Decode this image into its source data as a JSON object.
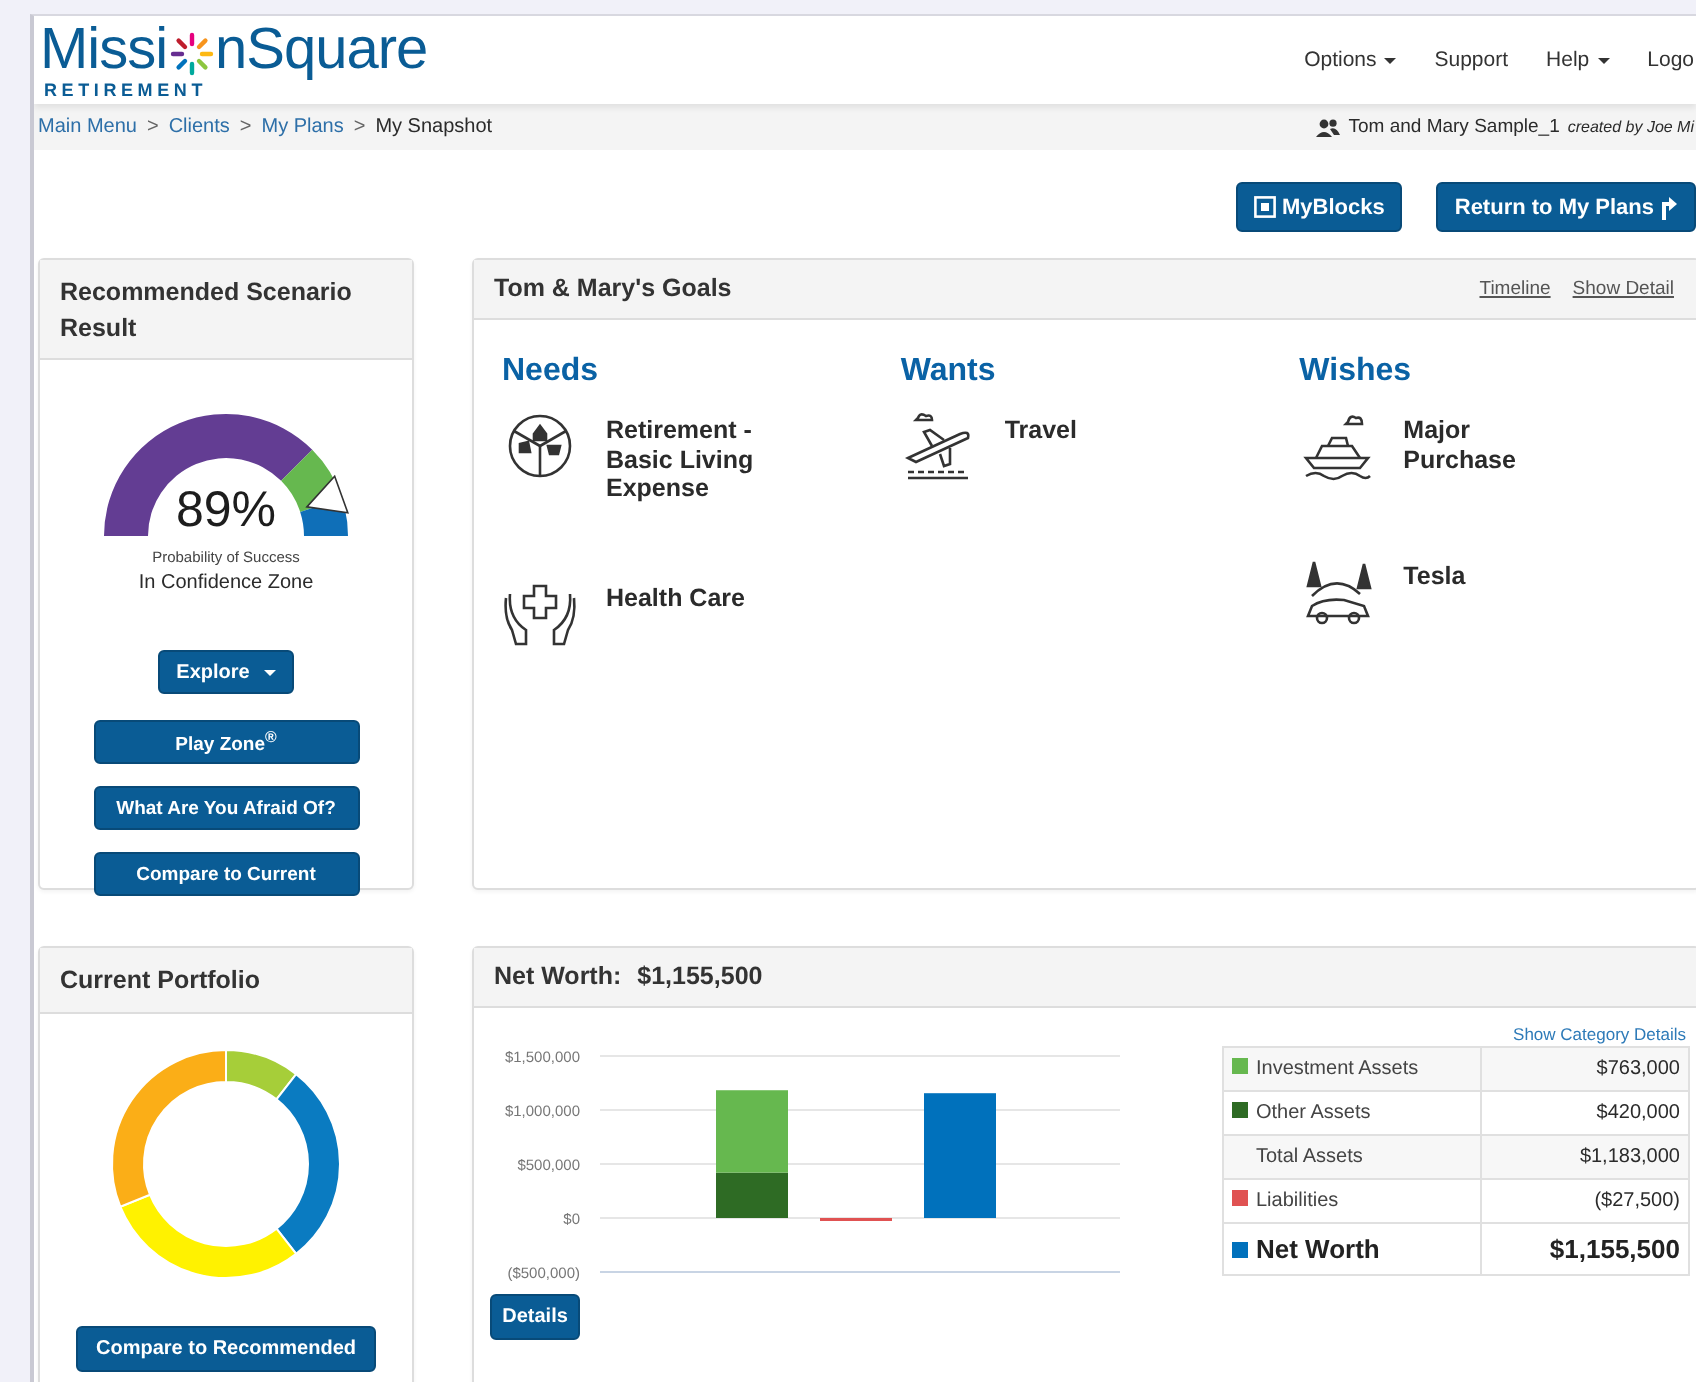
{
  "header": {
    "logo": {
      "before": "Missi",
      "after": "nSquare",
      "tagline": "RETIREMENT"
    },
    "nav": [
      {
        "label": "Options",
        "dropdown": true
      },
      {
        "label": "Support",
        "dropdown": false
      },
      {
        "label": "Help",
        "dropdown": true
      },
      {
        "label": "Logo",
        "dropdown": false
      }
    ]
  },
  "breadcrumb": {
    "separator": ">",
    "items": [
      {
        "label": "Main Menu",
        "link": true
      },
      {
        "label": "Clients",
        "link": true
      },
      {
        "label": "My Plans",
        "link": true
      },
      {
        "label": "My Snapshot",
        "link": false
      }
    ],
    "user": "Tom and Mary Sample_1",
    "created_by": "created by Joe Mi"
  },
  "actions": [
    "MyBlocks",
    "Return to My Plans"
  ],
  "scenario": {
    "title": "Recommended Scenario Result",
    "level": 0.89,
    "percent": "89%",
    "caption": "Probability of Success",
    "zone": "In Confidence Zone",
    "explore": "Explore",
    "buttons": [
      "Play Zone$^{®}$",
      "What Are You Afraid Of?",
      "Compare to Current"
    ]
  },
  "goals": {
    "title": "Tom & Mary's Goals",
    "links": [
      "Timeline",
      "Show Detail"
    ],
    "groups": [
      {
        "title": "Needs",
        "items": [
          "Retirement - Basic Living Expense",
          "Health Care"
        ]
      },
      {
        "title": "Wants",
        "items": [
          "Travel"
        ]
      },
      {
        "title": "Wishes",
        "items": [
          "Major Purchase",
          "Tesla"
        ]
      }
    ]
  },
  "portfolio": {
    "title": "Current Portfolio",
    "button": "Compare to Recommended"
  },
  "net_worth": {
    "label": "Net Worth:",
    "value": "$1,155,500",
    "details_link": "Show Category Details",
    "button": "Details",
    "rows": [
      {
        "label": "Investment Assets",
        "value": "$763,000",
        "kind": "item",
        "color": "#66b84f"
      },
      {
        "label": "Other Assets",
        "value": "$420,000",
        "kind": "item",
        "color": "#2e6b24"
      },
      {
        "label": "Total Assets",
        "value": "$1,183,000",
        "kind": "total"
      },
      {
        "label": "Liabilities",
        "value": "($27,500)",
        "kind": "item",
        "color": "#e05252"
      },
      {
        "label": "Net Worth",
        "value": "$1,155,500",
        "kind": "net",
        "color": "#0071bc"
      }
    ],
    "chart_data": {
      "type": "bar",
      "stacked": true,
      "grid": true,
      "ylim": [
        -500000,
        1500000
      ],
      "yticks": [
        {
          "value": 1500000,
          "label": "$1,500,000"
        },
        {
          "value": 1000000,
          "label": "$1,000,000"
        },
        {
          "value": 500000,
          "label": "$500,000"
        },
        {
          "value": 0,
          "label": "$0"
        },
        {
          "value": -500000,
          "label": "($500,000)"
        }
      ],
      "series": [
        {
          "color": "#2e6b24",
          "values": [
            420000,
            null,
            null
          ]
        },
        {
          "color": "#66b84f",
          "values": [
            763000,
            null,
            null
          ]
        },
        {
          "color": "#e05252",
          "values": [
            null,
            -27500,
            null
          ]
        },
        {
          "color": "#0071bc",
          "values": [
            null,
            null,
            1155500
          ]
        }
      ]
    }
  }
}
